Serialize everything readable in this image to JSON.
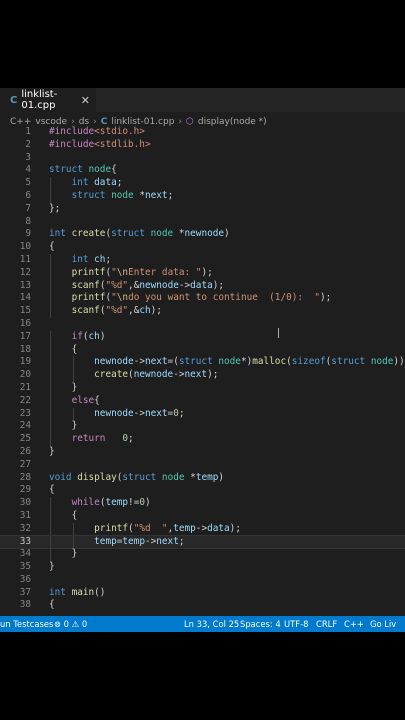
{
  "tab": {
    "label": "linklist-01.cpp",
    "close_glyph": "✕"
  },
  "breadcrumb": {
    "folder1": "vscode",
    "folder2": "ds",
    "file": "linklist-01.cpp",
    "symbol": "display(node *)"
  },
  "code_lines": [
    {
      "n": "1",
      "indent": 1,
      "parts": [
        [
          "pp",
          "#include"
        ],
        [
          "inc",
          "<stdio.h>"
        ]
      ]
    },
    {
      "n": "2",
      "indent": 1,
      "parts": [
        [
          "pp",
          "#include"
        ],
        [
          "inc",
          "<stdlib.h>"
        ]
      ]
    },
    {
      "n": "3",
      "indent": 0,
      "parts": []
    },
    {
      "n": "4",
      "indent": 0,
      "parts": [
        [
          "kw",
          "struct "
        ],
        [
          "ty",
          "node"
        ],
        [
          "p",
          "{"
        ]
      ]
    },
    {
      "n": "5",
      "indent": 0,
      "parts": [
        [
          "p",
          "    "
        ],
        [
          "kw",
          "int "
        ],
        [
          "var",
          "data"
        ],
        [
          "p",
          ";"
        ]
      ]
    },
    {
      "n": "6",
      "indent": 0,
      "parts": [
        [
          "p",
          "    "
        ],
        [
          "kw",
          "struct "
        ],
        [
          "ty",
          "node "
        ],
        [
          "p",
          "*"
        ],
        [
          "var",
          "next"
        ],
        [
          "p",
          ";"
        ]
      ]
    },
    {
      "n": "7",
      "indent": 0,
      "parts": [
        [
          "p",
          "};"
        ]
      ]
    },
    {
      "n": "8",
      "indent": 0,
      "parts": []
    },
    {
      "n": "9",
      "indent": 0,
      "parts": [
        [
          "kw",
          "int "
        ],
        [
          "fn",
          "create"
        ],
        [
          "p",
          "("
        ],
        [
          "kw",
          "struct "
        ],
        [
          "ty",
          "node "
        ],
        [
          "p",
          "*"
        ],
        [
          "var",
          "newnode"
        ],
        [
          "p",
          ")"
        ]
      ]
    },
    {
      "n": "10",
      "indent": 0,
      "parts": [
        [
          "p",
          "{"
        ]
      ]
    },
    {
      "n": "11",
      "indent": 0,
      "parts": [
        [
          "p",
          "    "
        ],
        [
          "kw",
          "int "
        ],
        [
          "var",
          "ch"
        ],
        [
          "p",
          ";"
        ]
      ]
    },
    {
      "n": "12",
      "indent": 0,
      "parts": [
        [
          "p",
          "    "
        ],
        [
          "fn",
          "printf"
        ],
        [
          "p",
          "("
        ],
        [
          "str",
          "\""
        ],
        [
          "esc",
          "\\n"
        ],
        [
          "str",
          "Enter data: \""
        ],
        [
          "p",
          ");"
        ]
      ]
    },
    {
      "n": "13",
      "indent": 0,
      "parts": [
        [
          "p",
          "    "
        ],
        [
          "fn",
          "scanf"
        ],
        [
          "p",
          "("
        ],
        [
          "str",
          "\"%d\""
        ],
        [
          "p",
          ",&"
        ],
        [
          "var",
          "newnode"
        ],
        [
          "p",
          "->"
        ],
        [
          "var",
          "data"
        ],
        [
          "p",
          ");"
        ]
      ]
    },
    {
      "n": "14",
      "indent": 0,
      "parts": [
        [
          "p",
          "    "
        ],
        [
          "fn",
          "printf"
        ],
        [
          "p",
          "("
        ],
        [
          "str",
          "\""
        ],
        [
          "esc",
          "\\n"
        ],
        [
          "str",
          "do you want to continue  (1/0):  \""
        ],
        [
          "p",
          ");"
        ]
      ]
    },
    {
      "n": "15",
      "indent": 0,
      "parts": [
        [
          "p",
          "    "
        ],
        [
          "fn",
          "scanf"
        ],
        [
          "p",
          "("
        ],
        [
          "str",
          "\"%d\""
        ],
        [
          "p",
          ",&"
        ],
        [
          "var",
          "ch"
        ],
        [
          "p",
          ");"
        ]
      ]
    },
    {
      "n": "16",
      "indent": 0,
      "parts": []
    },
    {
      "n": "17",
      "indent": 0,
      "parts": [
        [
          "p",
          "    "
        ],
        [
          "ctl",
          "if"
        ],
        [
          "p",
          "("
        ],
        [
          "var",
          "ch"
        ],
        [
          "p",
          ")"
        ]
      ]
    },
    {
      "n": "18",
      "indent": 0,
      "parts": [
        [
          "p",
          "    {"
        ]
      ]
    },
    {
      "n": "19",
      "indent": 0,
      "parts": [
        [
          "p",
          "        "
        ],
        [
          "var",
          "newnode"
        ],
        [
          "p",
          "->"
        ],
        [
          "var",
          "next"
        ],
        [
          "p",
          "=("
        ],
        [
          "kw",
          "struct "
        ],
        [
          "ty",
          "node"
        ],
        [
          "p",
          "*)"
        ],
        [
          "fn",
          "malloc"
        ],
        [
          "p",
          "("
        ],
        [
          "kw",
          "sizeof"
        ],
        [
          "p",
          "("
        ],
        [
          "kw",
          "struct "
        ],
        [
          "ty",
          "node"
        ],
        [
          "p",
          "));"
        ]
      ]
    },
    {
      "n": "20",
      "indent": 0,
      "parts": [
        [
          "p",
          "        "
        ],
        [
          "fn",
          "create"
        ],
        [
          "p",
          "("
        ],
        [
          "var",
          "newnode"
        ],
        [
          "p",
          "->"
        ],
        [
          "var",
          "next"
        ],
        [
          "p",
          ");"
        ]
      ]
    },
    {
      "n": "21",
      "indent": 0,
      "parts": [
        [
          "p",
          "    }"
        ]
      ]
    },
    {
      "n": "22",
      "indent": 0,
      "parts": [
        [
          "p",
          "    "
        ],
        [
          "ctl",
          "else"
        ],
        [
          "p",
          "{"
        ]
      ]
    },
    {
      "n": "23",
      "indent": 0,
      "parts": [
        [
          "p",
          "        "
        ],
        [
          "var",
          "newnode"
        ],
        [
          "p",
          "->"
        ],
        [
          "var",
          "next"
        ],
        [
          "p",
          "="
        ],
        [
          "num",
          "0"
        ],
        [
          "p",
          ";"
        ]
      ]
    },
    {
      "n": "24",
      "indent": 0,
      "parts": [
        [
          "p",
          "    }"
        ]
      ]
    },
    {
      "n": "25",
      "indent": 0,
      "parts": [
        [
          "p",
          "    "
        ],
        [
          "ctl",
          "return "
        ],
        [
          "p",
          "  "
        ],
        [
          "num",
          "0"
        ],
        [
          "p",
          ";"
        ]
      ]
    },
    {
      "n": "26",
      "indent": 0,
      "parts": [
        [
          "p",
          "}"
        ]
      ]
    },
    {
      "n": "27",
      "indent": 0,
      "parts": []
    },
    {
      "n": "28",
      "indent": 0,
      "parts": [
        [
          "kw",
          "void "
        ],
        [
          "fn",
          "display"
        ],
        [
          "p",
          "("
        ],
        [
          "kw",
          "struct "
        ],
        [
          "ty",
          "node "
        ],
        [
          "p",
          "*"
        ],
        [
          "var",
          "temp"
        ],
        [
          "p",
          ")"
        ]
      ]
    },
    {
      "n": "29",
      "indent": 0,
      "parts": [
        [
          "p",
          "{"
        ]
      ]
    },
    {
      "n": "30",
      "indent": 0,
      "parts": [
        [
          "p",
          "    "
        ],
        [
          "ctl",
          "while"
        ],
        [
          "p",
          "("
        ],
        [
          "var",
          "temp"
        ],
        [
          "p",
          "!="
        ],
        [
          "num",
          "0"
        ],
        [
          "p",
          ")"
        ]
      ]
    },
    {
      "n": "31",
      "indent": 0,
      "parts": [
        [
          "p",
          "    {"
        ]
      ]
    },
    {
      "n": "32",
      "indent": 0,
      "parts": [
        [
          "p",
          "        "
        ],
        [
          "fn",
          "printf"
        ],
        [
          "p",
          "("
        ],
        [
          "str",
          "\"%d  \""
        ],
        [
          "p",
          ","
        ],
        [
          "var",
          "temp"
        ],
        [
          "p",
          "->"
        ],
        [
          "var",
          "data"
        ],
        [
          "p",
          ");"
        ]
      ]
    },
    {
      "n": "33",
      "indent": 0,
      "cur": true,
      "parts": [
        [
          "p",
          "        "
        ],
        [
          "var",
          "temp"
        ],
        [
          "p",
          "="
        ],
        [
          "var",
          "temp"
        ],
        [
          "p",
          "->"
        ],
        [
          "var",
          "next"
        ],
        [
          "p",
          ";"
        ]
      ]
    },
    {
      "n": "34",
      "indent": 0,
      "parts": [
        [
          "p",
          "    }"
        ]
      ]
    },
    {
      "n": "35",
      "indent": 0,
      "parts": [
        [
          "p",
          "}"
        ]
      ]
    },
    {
      "n": "36",
      "indent": 0,
      "parts": []
    },
    {
      "n": "37",
      "indent": 0,
      "parts": [
        [
          "kw",
          "int "
        ],
        [
          "fn",
          "main"
        ],
        [
          "p",
          "()"
        ]
      ]
    },
    {
      "n": "38",
      "indent": 0,
      "parts": [
        [
          "p",
          "{"
        ]
      ]
    }
  ],
  "status": {
    "left": "un Testcases",
    "problems": "⊗ 0 ⚠ 0",
    "position": "Ln 33, Col 25",
    "spaces": "Spaces: 4",
    "encoding": "UTF-8",
    "eol": "CRLF",
    "language": "C++",
    "golive": "Go Liv"
  }
}
